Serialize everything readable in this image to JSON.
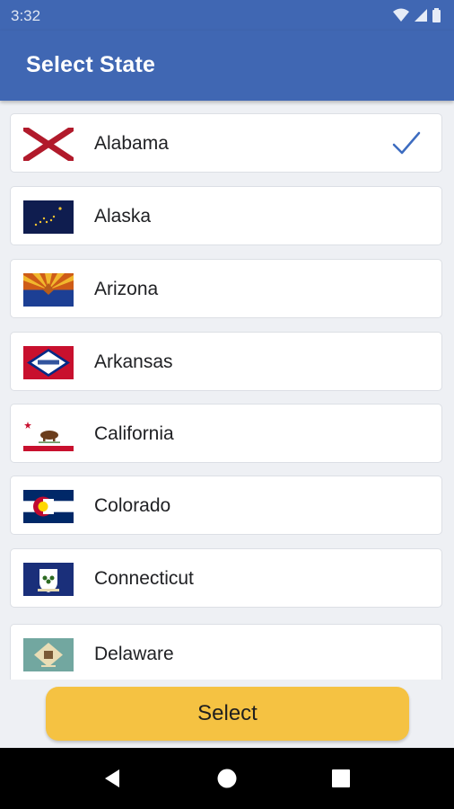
{
  "status_bar": {
    "time": "3:32",
    "icons": [
      "wifi-icon",
      "cell-signal-icon",
      "battery-icon"
    ]
  },
  "app_bar": {
    "title": "Select State"
  },
  "states": [
    {
      "name": "Alabama",
      "selected": true
    },
    {
      "name": "Alaska",
      "selected": false
    },
    {
      "name": "Arizona",
      "selected": false
    },
    {
      "name": "Arkansas",
      "selected": false
    },
    {
      "name": "California",
      "selected": false
    },
    {
      "name": "Colorado",
      "selected": false
    },
    {
      "name": "Connecticut",
      "selected": false
    },
    {
      "name": "Delaware",
      "selected": false
    }
  ],
  "select_button": {
    "label": "Select"
  },
  "nav_bar": {
    "icons": [
      "back-icon",
      "home-icon",
      "recents-icon"
    ]
  },
  "colors": {
    "app_bar": "#4067b3",
    "button": "#f5c242",
    "check": "#3d6cc0"
  }
}
